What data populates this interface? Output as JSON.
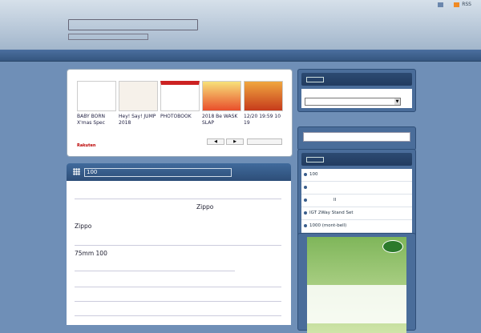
{
  "header": {
    "top_links": [
      {
        "icon": "home-icon",
        "label": ""
      },
      {
        "icon": "rss-icon",
        "label": "RSS"
      }
    ],
    "site_title": "",
    "site_description": ""
  },
  "ads": {
    "items": [
      {
        "caption": "BABY BORN X'mas Spec"
      },
      {
        "caption": "Hey! Say! JUMP 2018"
      },
      {
        "caption": "PHOTOBOOK"
      },
      {
        "caption": "2018 Be WASK SLAP"
      },
      {
        "caption": "12/20 19:59 10 19"
      }
    ],
    "footer_brand": "Rakuten",
    "nav_prev": "◀",
    "nav_next": "▶",
    "link_label": ""
  },
  "post": {
    "title": "100",
    "paragraphs": [
      {
        "text": "Zippo"
      },
      {
        "text": "Zippo"
      },
      {
        "text": "75mm 100"
      },
      {
        "text": ""
      }
    ]
  },
  "sidebar": {
    "archive": {
      "title": "",
      "select_label": "",
      "select_value": ""
    },
    "search": {
      "title": "",
      "placeholder": ""
    },
    "categories": {
      "title": "",
      "items": [
        {
          "label": "100"
        },
        {
          "label": ""
        },
        {
          "label": "II"
        },
        {
          "label": "IGT 2Way Stand Set"
        },
        {
          "label": "1000 (mont-bell)"
        }
      ]
    },
    "banner": {
      "badge": "",
      "title": ""
    }
  },
  "colors": {
    "accent": "#2d4e78",
    "background": "#6f8fb7",
    "header": "#b7c7d8"
  }
}
